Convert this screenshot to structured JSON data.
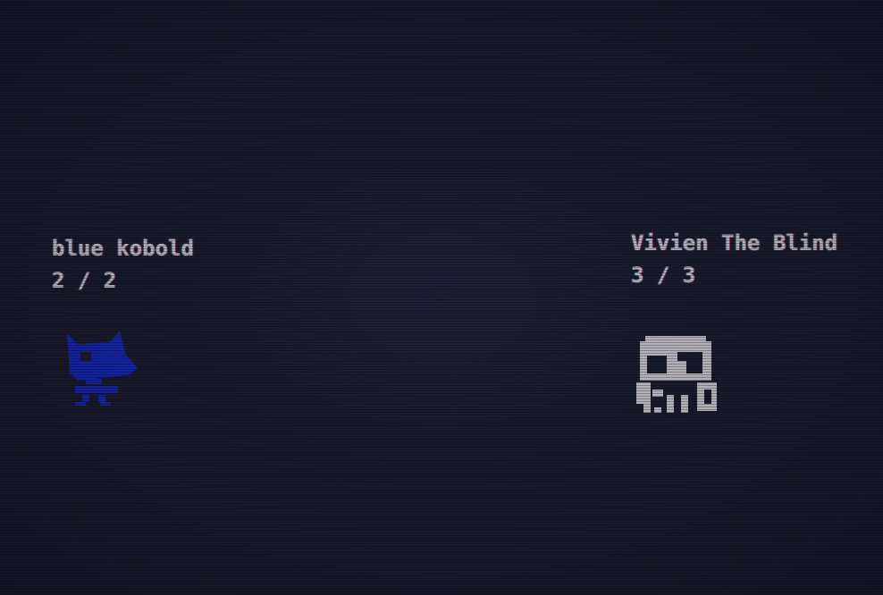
{
  "units": [
    {
      "name": "blue kobold",
      "hp": "2 / 2",
      "icon": "kobold-icon",
      "color": "#1428d2"
    },
    {
      "name": "Vivien The Blind",
      "hp": "3 / 3",
      "icon": "skull-icon",
      "color": "#f2eef2"
    }
  ]
}
